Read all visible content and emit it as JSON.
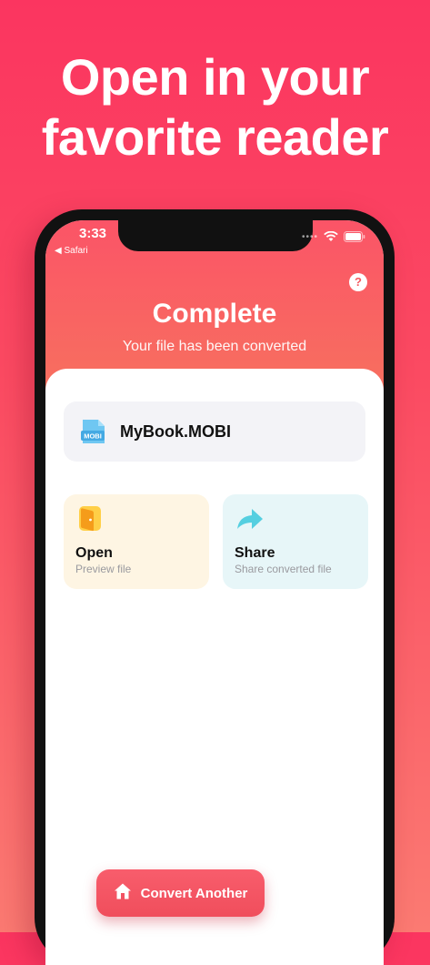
{
  "headline": {
    "line1": "Open in your",
    "line2": "favorite reader"
  },
  "status_bar": {
    "time": "3:33",
    "back_label": "◀ Safari",
    "signal_dots": "••••"
  },
  "header": {
    "help_label": "?",
    "title": "Complete",
    "subtitle": "Your file has been converted"
  },
  "file": {
    "name": "MyBook.MOBI",
    "icon_text": "MOBI",
    "icon": "mobi-file-icon"
  },
  "actions": [
    {
      "title": "Open",
      "subtitle": "Preview file",
      "icon": "door-icon"
    },
    {
      "title": "Share",
      "subtitle": "Share converted file",
      "icon": "share-arrow-icon"
    }
  ],
  "convert_button": {
    "label": "Convert Another",
    "icon": "home-icon"
  },
  "colors": {
    "accent": "#f5575f",
    "open_tile": "#fef5e3",
    "share_tile": "#e7f6f8"
  }
}
